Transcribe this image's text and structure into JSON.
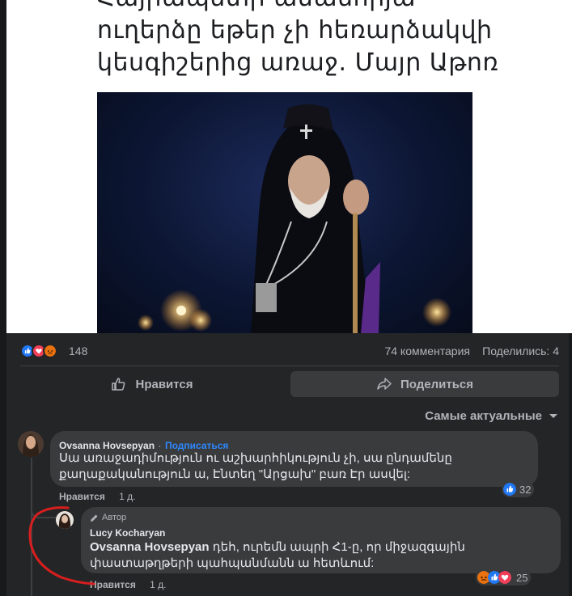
{
  "article": {
    "headline_lines": [
      "Հայրապետի անասորյա",
      "ուղերձը եթեր չի հեռարձակվի",
      "կեսգիշերից առաջ. Մայր Աթոռ"
    ]
  },
  "stats": {
    "reactions_count": "148",
    "comments": "74 комментария",
    "shares": "Поделились: 4"
  },
  "actions": {
    "like": "Нравится",
    "share": "Поделиться"
  },
  "sort": {
    "label": "Самые актуальные"
  },
  "comments": [
    {
      "author": "Ovsanna Hovsepyan",
      "follow": "Подписаться",
      "text": "Սա առաջադիմություն ու աշխարհիկություն չի, սա ընդամենը քաղաքականություն ա, Էնտեղ \"Արցախ\" բառ Էր ասվել:",
      "like": "Нравится",
      "time": "1 д.",
      "reactions": "32"
    }
  ],
  "reply": {
    "badge": "Автор",
    "author": "Lucy Kocharyan",
    "mention": "Ovsanna Hovsepyan",
    "text": " դեհ, ուրեմն ապրի Հ1-ը, որ միջազգային փաստաթղթերի պահպանմանն ա հետևում:",
    "like": "Нравится",
    "time": "1 д.",
    "reactions": "25"
  },
  "colors": {
    "like_blue": "#2078f4",
    "love_red": "#f33e58",
    "angry_orange": "#e9710f",
    "link_blue": "#2d88ff",
    "annotation_red": "#d81e1e"
  }
}
